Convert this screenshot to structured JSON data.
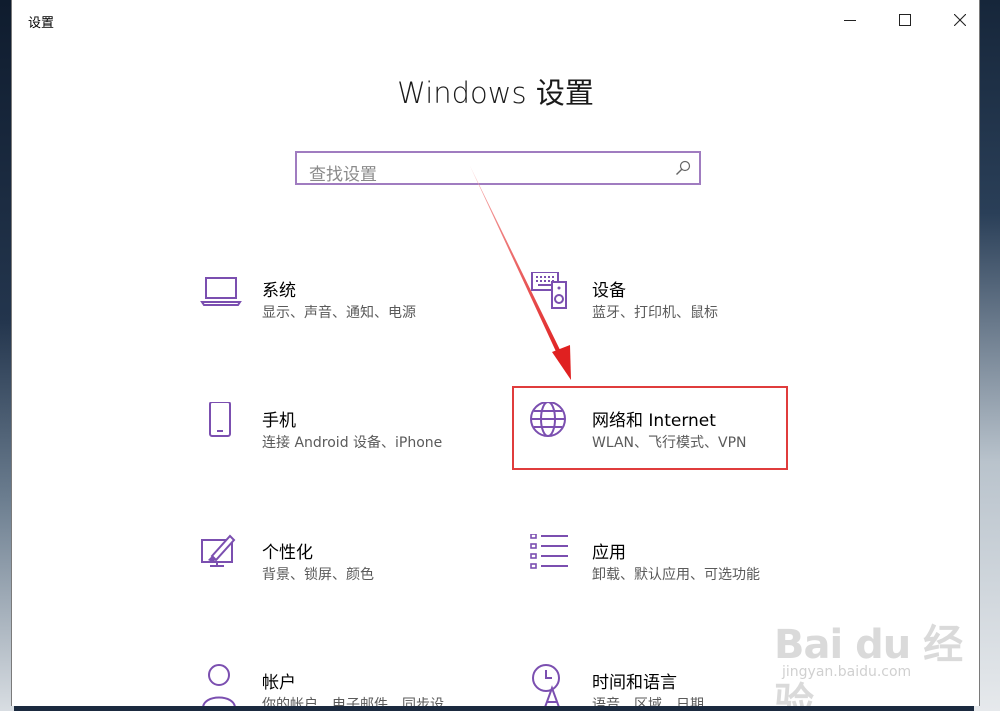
{
  "window": {
    "title": "设置",
    "controls": [
      "minimize-icon",
      "maximize-icon",
      "close-icon"
    ]
  },
  "page": {
    "title": "Windows 设置"
  },
  "search": {
    "placeholder": "查找设置",
    "icon": "search-icon"
  },
  "accent": "#7b4fb0",
  "highlight_color": "#e03c3c",
  "tiles": [
    {
      "icon": "laptop-icon",
      "title": "系统",
      "subtitle": "显示、声音、通知、电源"
    },
    {
      "icon": "keyboard-speaker-icon",
      "title": "设备",
      "subtitle": "蓝牙、打印机、鼠标"
    },
    {
      "icon": "phone-icon",
      "title": "手机",
      "subtitle": "连接 Android 设备、iPhone"
    },
    {
      "icon": "globe-icon",
      "title": "网络和 Internet",
      "subtitle": "WLAN、飞行模式、VPN"
    },
    {
      "icon": "paint-brush-icon",
      "title": "个性化",
      "subtitle": "背景、锁屏、颜色"
    },
    {
      "icon": "app-list-icon",
      "title": "应用",
      "subtitle": "卸载、默认应用、可选功能"
    },
    {
      "icon": "person-icon",
      "title": "帐户",
      "subtitle": "你的帐户、电子邮件、同步设"
    },
    {
      "icon": "time-language-icon",
      "title": "时间和语言",
      "subtitle": "语音、区域、日期"
    }
  ],
  "watermark": {
    "main": "Bai du 经验",
    "sub": "jingyan.baidu.com"
  }
}
